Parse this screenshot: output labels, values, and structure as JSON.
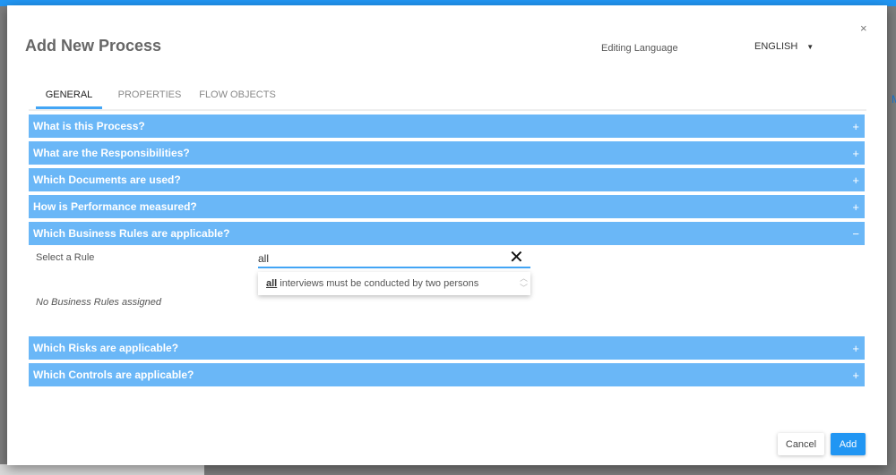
{
  "background": {
    "partial_text": "M"
  },
  "dialog": {
    "title": "Add New Process",
    "close_icon": "×",
    "editing_language_label": "Editing Language",
    "language": "ENGLISH",
    "tabs": [
      {
        "label": "GENERAL"
      },
      {
        "label": "PROPERTIES"
      },
      {
        "label": "FLOW OBJECTS"
      }
    ],
    "sections": [
      {
        "label": "What is this Process?",
        "sign": "+"
      },
      {
        "label": "What are the Responsibilities?",
        "sign": "+"
      },
      {
        "label": "Which Documents are used?",
        "sign": "+"
      },
      {
        "label": "How is Performance measured?",
        "sign": "+"
      },
      {
        "label": "Which Business Rules are applicable?",
        "sign": "−"
      },
      {
        "label": "Which Risks are applicable?",
        "sign": "+"
      },
      {
        "label": "Which Controls are applicable?",
        "sign": "+"
      }
    ],
    "rules": {
      "select_label": "Select a Rule",
      "input_value": "all",
      "suggestion_match": "all",
      "suggestion_rest": " interviews must be conducted by two persons",
      "empty_text": "No Business Rules assigned"
    },
    "cancel_label": "Cancel",
    "add_label": "Add"
  }
}
